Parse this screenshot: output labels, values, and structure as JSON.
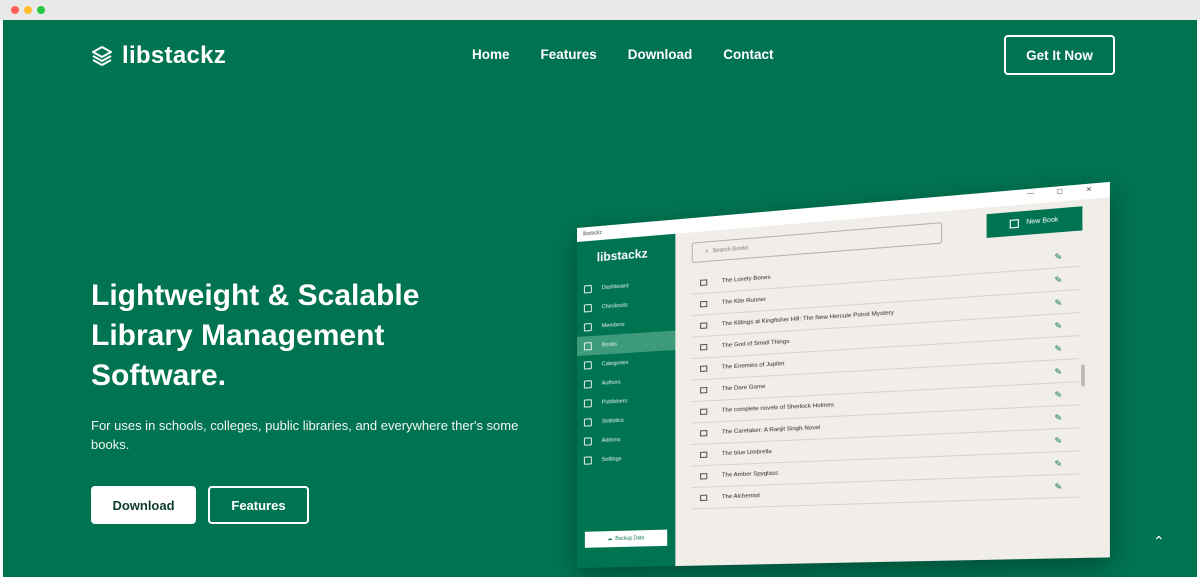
{
  "brand": {
    "name": "libstackz"
  },
  "nav": {
    "items": [
      "Home",
      "Features",
      "Download",
      "Contact"
    ],
    "cta": "Get It Now"
  },
  "hero": {
    "title_line1": "Lightweight & Scalable",
    "title_line2": "Library Management",
    "title_line3": "Software.",
    "subtitle": "For uses in schools, colleges, public libraries, and everywhere ther's some books.",
    "download_button": "Download",
    "features_button": "Features"
  },
  "app": {
    "window_title": "libstackz",
    "sidebar_logo": "libstackz",
    "sidebar_items": [
      "Dashboard",
      "Checkouts",
      "Members",
      "Books",
      "Categories",
      "Authors",
      "Publishers",
      "Statistics",
      "Addons",
      "Settings"
    ],
    "active_item": "Books",
    "backup_label": "Backup Data",
    "search_placeholder": "Search Books",
    "new_book_label": "New Book",
    "books": [
      "The Lovely Bones",
      "The Kite Runner",
      "The Killings at Kingfisher Hill: The New Hercule Poirot Mystery",
      "The God of Small Things",
      "The Enemies of Jupiter",
      "The Dare Game",
      "The complete novels of Sherlock Holmes",
      "The Caretaker: A Ranjit Singh Novel",
      "The blue Umbrella",
      "The Amber Spyglass",
      "The Alchemist"
    ]
  },
  "colors": {
    "brand_green": "#007451",
    "active_green": "#3d9a7a",
    "list_bg": "#f1ede8"
  }
}
